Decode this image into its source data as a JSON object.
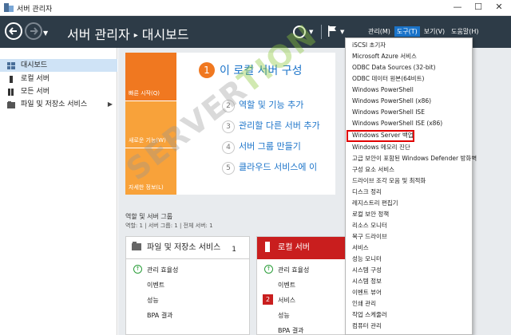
{
  "window": {
    "title": "서버 관리자",
    "controls": [
      "—",
      "☐",
      "✕"
    ]
  },
  "header": {
    "breadcrumb_root": "서버 관리자",
    "breadcrumb_sep": "▸",
    "breadcrumb_page": "대시보드",
    "menus": [
      "관리(M)",
      "도구(T)",
      "보기(V)",
      "도움말(H)"
    ],
    "active_menu": "도구(T)"
  },
  "sidebar": {
    "items": [
      {
        "label": "대시보드",
        "icon": "dashboard-icon"
      },
      {
        "label": "로컬 서버",
        "icon": "server-icon"
      },
      {
        "label": "모든 서버",
        "icon": "servers-icon"
      },
      {
        "label": "파일 및 저장소 서비스",
        "icon": "storage-icon",
        "arrow": "▶"
      }
    ]
  },
  "welcome": {
    "tiles": [
      "빠른 시작(Q)",
      "새로운 기능(W)",
      "자세한 정보(L)"
    ],
    "main_step": {
      "num": "1",
      "label": "이 로컬 서버 구성"
    },
    "steps": [
      {
        "num": "2",
        "label": "역할 및 기능 추가"
      },
      {
        "num": "3",
        "label": "관리할 다른 서버 추가"
      },
      {
        "num": "4",
        "label": "서버 그룹 만들기"
      },
      {
        "num": "5",
        "label": "클라우드 서비스에 이"
      }
    ]
  },
  "roles": {
    "title": "역할 및 서버 그룹",
    "subtitle": "역할: 1   |   서버 그룹: 1   |   전체 서버: 1",
    "cards": [
      {
        "title": "파일 및 저장소 서비스",
        "count": "1",
        "rows": [
          "관리 효율성",
          "이벤트",
          "성능",
          "BPA 결과"
        ]
      },
      {
        "title": "로컬 서버",
        "count": "",
        "rows": [
          "관리 효율성",
          "이벤트",
          "서비스",
          "성능",
          "BPA 결과"
        ],
        "badge": "2"
      }
    ]
  },
  "tools_menu": {
    "items": [
      "iSCSI 초기자",
      "Microsoft Azure 서비스",
      "ODBC Data Sources (32-bit)",
      "ODBC 데이터 원본(64비트)",
      "Windows PowerShell",
      "Windows PowerShell (x86)",
      "Windows PowerShell ISE",
      "Windows PowerShell ISE (x86)",
      "Windows Server 백업",
      "Windows 메모리 진단",
      "고급 보안이 포함된 Windows Defender 방화벽",
      "구성 요소 서비스",
      "드라이브 조각 모음 및 최적화",
      "디스크 정리",
      "레지스트리 편집기",
      "로컬 보안 정책",
      "리소스 모니터",
      "복구 드라이브",
      "서비스",
      "성능 모니터",
      "시스템 구성",
      "시스템 정보",
      "이벤트 뷰어",
      "인쇄 관리",
      "작업 스케줄러",
      "컴퓨터 관리"
    ],
    "highlighted": "Windows Server 백업"
  },
  "watermark": {
    "part1": "SERVER",
    "part2": "TION"
  },
  "colors": {
    "header_bg": "#2d3b47",
    "accent_blue": "#1a73c9",
    "tile_orange": "#f07820",
    "tile_light_orange": "#f8a23a",
    "alert_red": "#c91e1e",
    "highlight_red": "#e00000",
    "ok_green": "#2a9d39"
  }
}
